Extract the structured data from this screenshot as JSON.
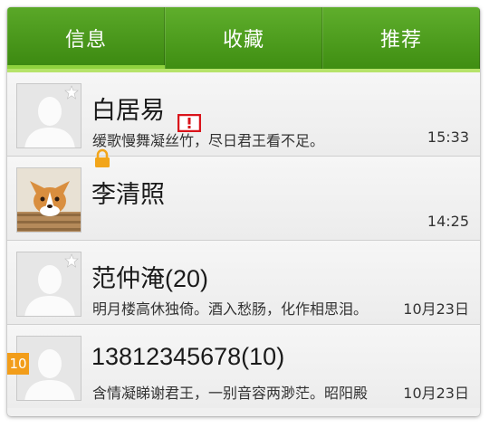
{
  "tabs": [
    {
      "label": "信息"
    },
    {
      "label": "收藏"
    },
    {
      "label": "推荐"
    }
  ],
  "conversations": [
    {
      "name": "白居易",
      "message": "缓歌慢舞凝丝竹，尽日君王看不足。",
      "time": "15:33",
      "starred": true
    },
    {
      "name": "李清照",
      "message": "",
      "time": "14:25",
      "alert": true,
      "locked": true,
      "avatar": "corgi-photo"
    },
    {
      "name": "范仲淹(20)",
      "message": "明月楼高休独倚。酒入愁肠，化作相思泪。",
      "time": "10月23日",
      "starred": true
    },
    {
      "name": "13812345678(10)",
      "message": "含情凝睇谢君王，一别音容两渺茫。昭阳殿",
      "time": "10月23日",
      "unread_badge": "10"
    }
  ],
  "colors": {
    "tabbar": "#4f9e1e",
    "underline": "#8fd23e",
    "badge": "#f29d1a",
    "alert": "#d9141b",
    "lock": "#f2a51a"
  }
}
